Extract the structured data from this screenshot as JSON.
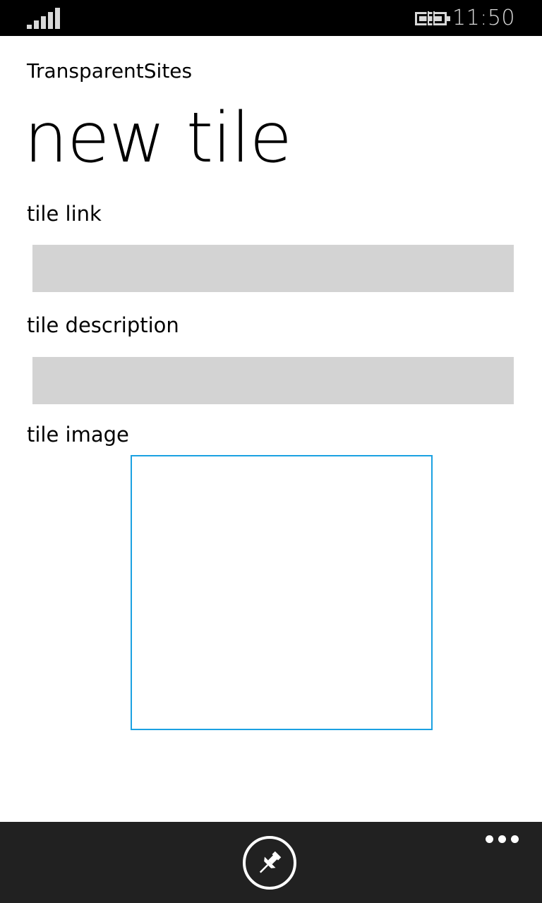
{
  "status_bar": {
    "time": "11:50",
    "icons": [
      "signal-strength-icon",
      "battery-charging-icon"
    ]
  },
  "header": {
    "app_name": "TransparentSites",
    "page_title": "new tile"
  },
  "form": {
    "tile_link": {
      "label": "tile link",
      "value": "",
      "placeholder": ""
    },
    "tile_description": {
      "label": "tile description",
      "value": "",
      "placeholder": ""
    },
    "tile_image": {
      "label": "tile image"
    }
  },
  "app_bar": {
    "buttons": [
      {
        "icon": "pin-icon"
      }
    ],
    "more_icon": "more-ellipsis-icon"
  },
  "colors": {
    "accent": "#1ba1e2",
    "textbox_bg": "#d3d3d3",
    "app_bar_bg": "#212121",
    "status_bar_bg": "#000000"
  }
}
